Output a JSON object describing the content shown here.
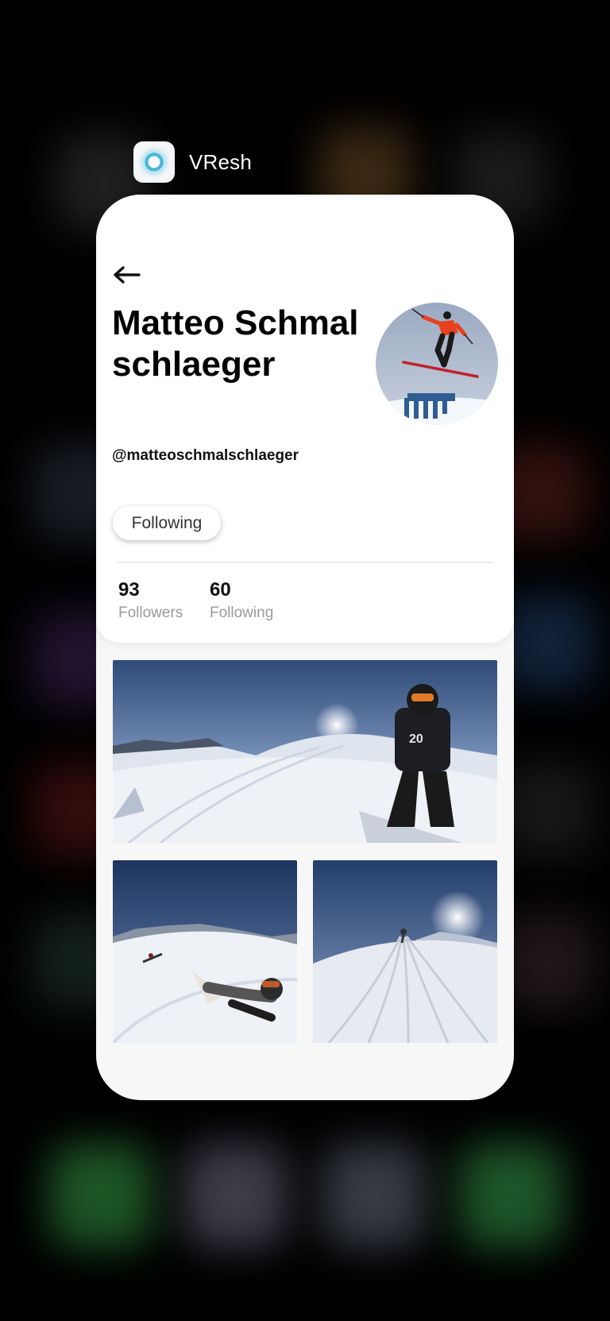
{
  "app": {
    "name": "VResh",
    "icon": "vresh-app-icon"
  },
  "profile": {
    "back_icon": "arrow-left-icon",
    "name": "Matteo Schmalschlaeger",
    "handle": "@matteoschmalschlaeger",
    "follow_button_label": "Following",
    "stats": [
      {
        "value": "93",
        "label": "Followers"
      },
      {
        "value": "60",
        "label": "Following"
      }
    ]
  },
  "colors": {
    "background": "#000000",
    "card": "#ffffff",
    "feed_background": "#f7f7f7",
    "stat_label": "#9a9a9a"
  }
}
